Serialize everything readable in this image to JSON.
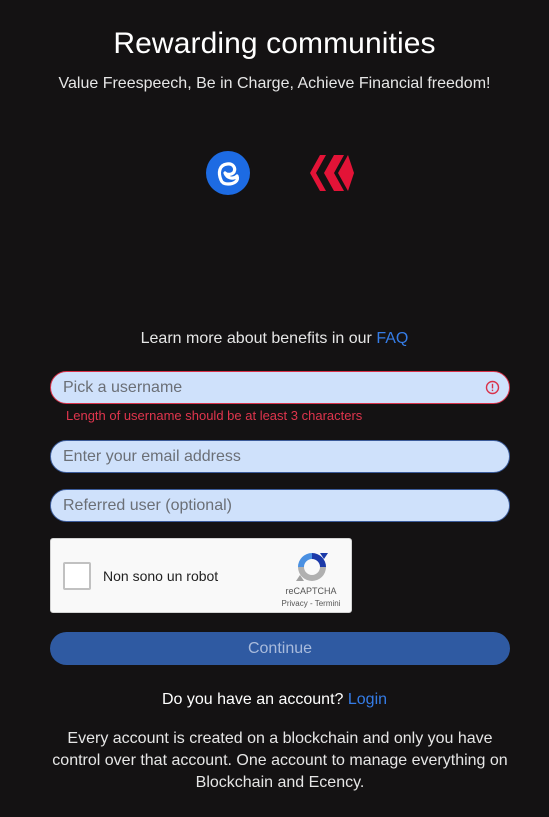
{
  "header": {
    "title": "Rewarding communities",
    "subtitle": "Value Freespeech, Be in Charge, Achieve Financial freedom!"
  },
  "logos": {
    "ecency_color": "#1d6be3",
    "hive_color": "#e31337"
  },
  "faq": {
    "text": "Learn more about benefits in our",
    "link_label": "FAQ"
  },
  "form": {
    "username": {
      "placeholder": "Pick a username",
      "value": "",
      "error": "Length of username should be at least 3 characters"
    },
    "email": {
      "placeholder": "Enter your email address",
      "value": ""
    },
    "referral": {
      "placeholder": "Referred user (optional)",
      "value": ""
    },
    "recaptcha": {
      "label": "Non sono un robot",
      "brand": "reCAPTCHA",
      "privacy": "Privacy",
      "separator": " - ",
      "terms": "Termini",
      "checked": false
    },
    "continue_label": "Continue"
  },
  "login": {
    "text": "Do you have an account?",
    "link_label": "Login"
  },
  "footer": {
    "text": "Every account is created on a blockchain and only you have control over that account. One account to manage everything on Blockchain and Ecency."
  },
  "colors": {
    "background": "#141213",
    "accent": "#357ce6",
    "error": "#e0354d",
    "button": "#2f5aa2"
  }
}
